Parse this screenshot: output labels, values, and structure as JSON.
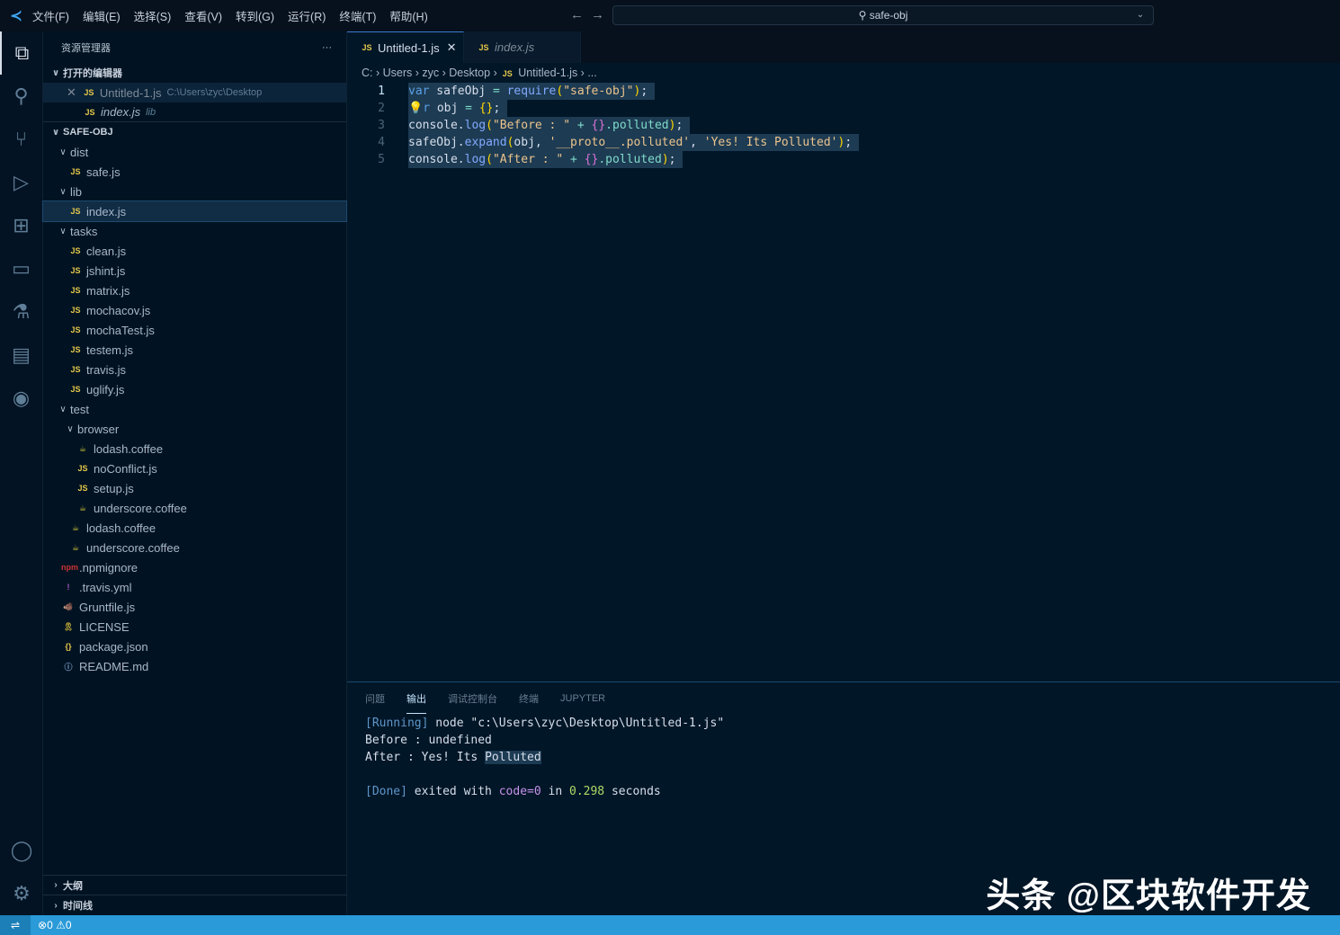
{
  "titlebar": {
    "menu": [
      "文件(F)",
      "编辑(E)",
      "选择(S)",
      "查看(V)",
      "转到(G)",
      "运行(R)",
      "终端(T)",
      "帮助(H)"
    ],
    "search": "safe-obj"
  },
  "activity": [
    "files-icon",
    "search-icon",
    "source-control-icon",
    "run-debug-icon",
    "extensions-icon",
    "remote-explorer-icon",
    "testing-icon",
    "notebook-icon",
    "git-graph-icon"
  ],
  "sidebar": {
    "title": "资源管理器",
    "more": "···",
    "open_editors": {
      "label": "打开的编辑器",
      "items": [
        {
          "name": "Untitled-1.js",
          "path": "C:\\Users\\zyc\\Desktop"
        },
        {
          "name": "index.js",
          "path": "lib"
        }
      ]
    },
    "project": "SAFE-OBJ",
    "tree": [
      {
        "name": "dist",
        "type": "folder",
        "level": 0
      },
      {
        "name": "safe.js",
        "type": "js",
        "level": 1
      },
      {
        "name": "lib",
        "type": "folder",
        "level": 0
      },
      {
        "name": "index.js",
        "type": "js",
        "level": 1,
        "selected": true
      },
      {
        "name": "tasks",
        "type": "folder",
        "level": 0
      },
      {
        "name": "clean.js",
        "type": "js",
        "level": 1
      },
      {
        "name": "jshint.js",
        "type": "js",
        "level": 1
      },
      {
        "name": "matrix.js",
        "type": "js",
        "level": 1
      },
      {
        "name": "mochacov.js",
        "type": "js",
        "level": 1
      },
      {
        "name": "mochaTest.js",
        "type": "js",
        "level": 1
      },
      {
        "name": "testem.js",
        "type": "js",
        "level": 1
      },
      {
        "name": "travis.js",
        "type": "js",
        "level": 1
      },
      {
        "name": "uglify.js",
        "type": "js",
        "level": 1
      },
      {
        "name": "test",
        "type": "folder",
        "level": 0
      },
      {
        "name": "browser",
        "type": "folder",
        "level": 1
      },
      {
        "name": "lodash.coffee",
        "type": "coffee",
        "level": 2
      },
      {
        "name": "noConflict.js",
        "type": "js",
        "level": 2
      },
      {
        "name": "setup.js",
        "type": "js",
        "level": 2
      },
      {
        "name": "underscore.coffee",
        "type": "coffee",
        "level": 2
      },
      {
        "name": "lodash.coffee",
        "type": "coffee",
        "level": 1
      },
      {
        "name": "underscore.coffee",
        "type": "coffee",
        "level": 1
      },
      {
        "name": ".npmignore",
        "type": "npm",
        "level": 0
      },
      {
        "name": ".travis.yml",
        "type": "yml",
        "level": 0
      },
      {
        "name": "Gruntfile.js",
        "type": "grunt",
        "level": 0
      },
      {
        "name": "LICENSE",
        "type": "license",
        "level": 0
      },
      {
        "name": "package.json",
        "type": "json",
        "level": 0
      },
      {
        "name": "README.md",
        "type": "md",
        "level": 0
      }
    ],
    "outline": "大纲",
    "timeline": "时间线"
  },
  "tabs": [
    {
      "label": "Untitled-1.js",
      "active": true
    },
    {
      "label": "index.js",
      "active": false
    }
  ],
  "breadcrumb": [
    "C:",
    "Users",
    "zyc",
    "Desktop",
    "Untitled-1.js",
    "..."
  ],
  "code": [
    [
      [
        "var",
        "kw"
      ],
      [
        " safeObj ",
        "pl"
      ],
      [
        "=",
        "op"
      ],
      [
        " ",
        "pl"
      ],
      [
        "require",
        "fn"
      ],
      [
        "(",
        "br"
      ],
      [
        "\"safe-obj\"",
        "str"
      ],
      [
        ")",
        "br"
      ],
      [
        ";",
        "pl"
      ]
    ],
    [
      [
        "💡",
        "pl"
      ],
      [
        "r",
        "kw"
      ],
      [
        " obj ",
        "pl"
      ],
      [
        "=",
        "op"
      ],
      [
        " ",
        "pl"
      ],
      [
        "{}",
        "br"
      ],
      [
        ";",
        "pl"
      ]
    ],
    [
      [
        "console.",
        "pl"
      ],
      [
        "log",
        "fn"
      ],
      [
        "(",
        "br"
      ],
      [
        "\"Before : \"",
        "str"
      ],
      [
        " + ",
        "op"
      ],
      [
        "{}",
        "br2"
      ],
      [
        ".polluted",
        "prop"
      ],
      [
        ")",
        "br"
      ],
      [
        ";",
        "pl"
      ]
    ],
    [
      [
        "safeObj.",
        "pl"
      ],
      [
        "expand",
        "fn"
      ],
      [
        "(",
        "br"
      ],
      [
        "obj, ",
        "pl"
      ],
      [
        "'__proto__.polluted'",
        "str"
      ],
      [
        ", ",
        "pl"
      ],
      [
        "'Yes! Its Polluted'",
        "str"
      ],
      [
        ")",
        "br"
      ],
      [
        ";",
        "pl"
      ]
    ],
    [
      [
        "console.",
        "pl"
      ],
      [
        "log",
        "fn"
      ],
      [
        "(",
        "br"
      ],
      [
        "\"After : \"",
        "str"
      ],
      [
        " + ",
        "op"
      ],
      [
        "{}",
        "br2"
      ],
      [
        ".polluted",
        "prop"
      ],
      [
        ")",
        "br"
      ],
      [
        ";",
        "pl"
      ]
    ]
  ],
  "panel": {
    "tabs": [
      "问题",
      "输出",
      "调试控制台",
      "终端",
      "JUPYTER"
    ],
    "active": 1,
    "output": {
      "running_tag": "[Running]",
      "running_cmd": " node \"c:\\Users\\zyc\\Desktop\\Untitled-1.js\"",
      "before": "Before : undefined",
      "after_prefix": "After : Yes! Its ",
      "after_hl": "Polluted",
      "done_tag": "[Done]",
      "done_a": " exited with ",
      "done_code": "code=0",
      "done_b": " in ",
      "done_time": "0.298",
      "done_c": " seconds"
    }
  },
  "status": {
    "errors": "0",
    "warnings": "0"
  },
  "watermark": "头条 @区块软件开发"
}
